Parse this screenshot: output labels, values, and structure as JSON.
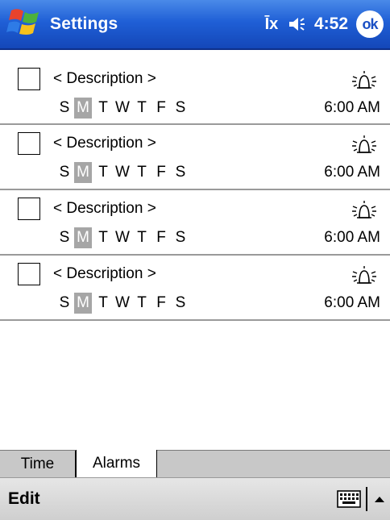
{
  "titlebar": {
    "title": "Settings",
    "connectivity": "Īx",
    "clock": "4:52",
    "ok_label": "ok",
    "start_icon": "windows-flag-icon",
    "volume_icon": "speaker-icon",
    "colors": {
      "bar": "#1f5fd6",
      "text": "#ffffff"
    }
  },
  "alarms": [
    {
      "checked": false,
      "description": "< Description >",
      "days": [
        "S",
        "M",
        "T",
        "W",
        "T",
        "F",
        "S"
      ],
      "active_day_index": 1,
      "time": "6:00 AM",
      "icon": "alarm-bell-icon"
    },
    {
      "checked": false,
      "description": "< Description >",
      "days": [
        "S",
        "M",
        "T",
        "W",
        "T",
        "F",
        "S"
      ],
      "active_day_index": 1,
      "time": "6:00 AM",
      "icon": "alarm-bell-icon"
    },
    {
      "checked": false,
      "description": "< Description >",
      "days": [
        "S",
        "M",
        "T",
        "W",
        "T",
        "F",
        "S"
      ],
      "active_day_index": 1,
      "time": "6:00 AM",
      "icon": "alarm-bell-icon"
    },
    {
      "checked": false,
      "description": "< Description >",
      "days": [
        "S",
        "M",
        "T",
        "W",
        "T",
        "F",
        "S"
      ],
      "active_day_index": 1,
      "time": "6:00 AM",
      "icon": "alarm-bell-icon"
    }
  ],
  "tabs": [
    {
      "label": "Time",
      "selected": false
    },
    {
      "label": "Alarms",
      "selected": true
    }
  ],
  "menubar": {
    "edit_label": "Edit",
    "keyboard_icon": "keyboard-icon",
    "sip_arrow_icon": "up-arrow-icon"
  }
}
